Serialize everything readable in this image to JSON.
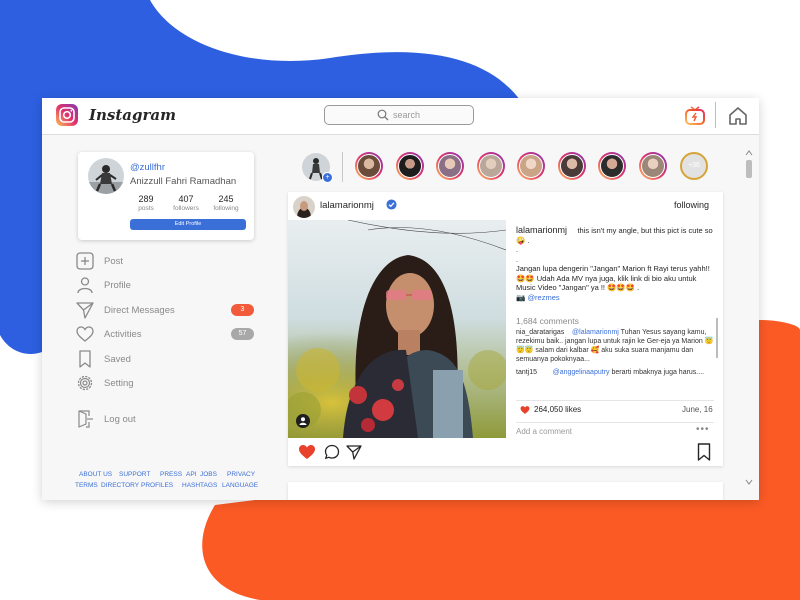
{
  "colors": {
    "blob_blue": "#2d5fe0",
    "blob_orange": "#fb5a25",
    "link_blue": "#3b6fd8",
    "badge_red": "#f15a3a",
    "badge_gray": "#a8a8a8",
    "heart_red": "#e8412c"
  },
  "header": {
    "logo_icon": "instagram-icon",
    "app_title": "Instagram",
    "search_placeholder": "search",
    "igtv_icon": "igtv-icon",
    "home_icon": "home-icon"
  },
  "profile": {
    "username": "@zullfhr",
    "full_name": "Anizzull Fahri Ramadhan",
    "stats": [
      {
        "value": "289",
        "label": "posts"
      },
      {
        "value": "407",
        "label": "followers"
      },
      {
        "value": "245",
        "label": "following"
      }
    ],
    "edit_label": "Edit Profile"
  },
  "menu": {
    "items": [
      {
        "icon": "plus-square-icon",
        "label": "Post"
      },
      {
        "icon": "user-icon",
        "label": "Profile"
      },
      {
        "icon": "paper-plane-icon",
        "label": "Direct Messages",
        "badge": "3"
      },
      {
        "icon": "heart-icon",
        "label": "Activities",
        "badge": "57"
      },
      {
        "icon": "bookmark-icon",
        "label": "Saved"
      },
      {
        "icon": "gear-icon",
        "label": "Setting"
      },
      {
        "icon": "logout-icon",
        "label": "Log out"
      }
    ]
  },
  "footer": {
    "row1": [
      "ABOUT US",
      "SUPPORT",
      "PRESS",
      "API",
      "JOBS",
      "PRIVACY"
    ],
    "row2": [
      "TERMS",
      "DIRECTORY",
      "PROFILES",
      "HASHTAGS",
      "LANGUAGE"
    ]
  },
  "stories": {
    "more_label": "+36"
  },
  "post": {
    "username": "lalamarionmj",
    "verified_icon": "verified-badge-icon",
    "follow_label": "following",
    "caption_user": "lalamarionmj",
    "caption_line1": "this isn't my angle, but this pict is cute so 🤪 .",
    "caption_dot1": ".",
    "caption_dot2": ".",
    "caption_line2": "Jangan lupa dengerin \"Jangan\" Marion ft Rayi terus yahh!! 🤩🤩 Udah Ada MV nya juga, klik link di bio aku untuk Music Video \"Jangan\" ya !! 🤩🤩🤩 .",
    "caption_camera": "📷",
    "caption_tag": "@rezmes",
    "comment_count": "1,684 comments",
    "comments": [
      {
        "user": "nia_daratarigas",
        "mention": "@lalamarionmj",
        "text": "Tuhan Yesus sayang kamu, rezekimu baik.. jangan lupa untuk rajin ke Ger-eja ya Marion 😇😇😇 salam dari kalbar 🥰 aku suka suara manjamu dan semuanya pokoknyaa..."
      },
      {
        "user": "tantj15",
        "mention": "@anggelinaaputry",
        "text": "berarti mbaknya juga harus...."
      }
    ],
    "likes": "264,050 likes",
    "date": "June, 16",
    "add_comment_placeholder": "Add a comment",
    "more_dots": "•••"
  }
}
